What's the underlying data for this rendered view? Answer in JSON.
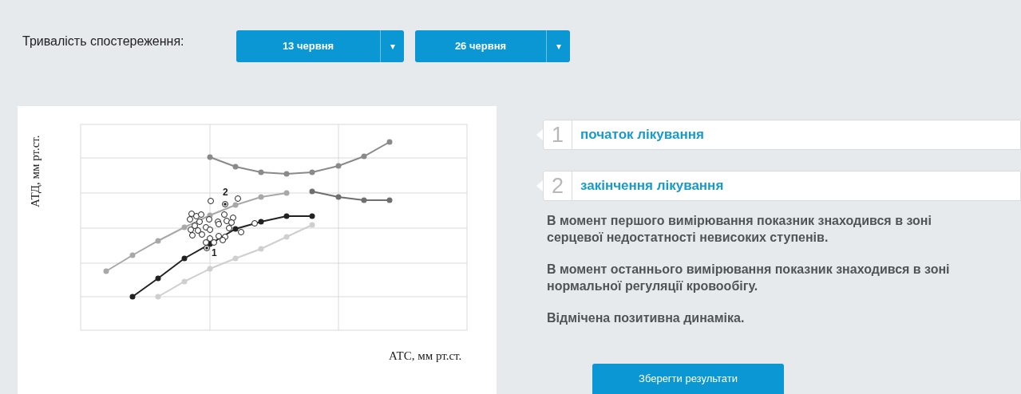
{
  "period": {
    "label": "Тривалість спостереження:",
    "dropdowns": [
      {
        "value": "13 червня",
        "caret": "▾"
      },
      {
        "value": "26 червня",
        "caret": "▾"
      }
    ]
  },
  "chart": {
    "ylabel": "АТД, мм рт.ст.",
    "xlabel": "АТС, мм рт.ст.",
    "point_labels": [
      "1",
      "2"
    ]
  },
  "steps": [
    {
      "number": "1",
      "label": "початок лікування"
    },
    {
      "number": "2",
      "label": "закінчення лікування"
    }
  ],
  "paragraphs": [
    "В момент першого вимірювання показник знаходився в зоні серцевої недостатності невисоких ступенів.",
    "В момент останнього вимірювання показник знаходився в зоні нормальної регуляції кровообігу.",
    "Відмічена позитивна динаміка."
  ],
  "save_button": "Зберегти результати"
}
